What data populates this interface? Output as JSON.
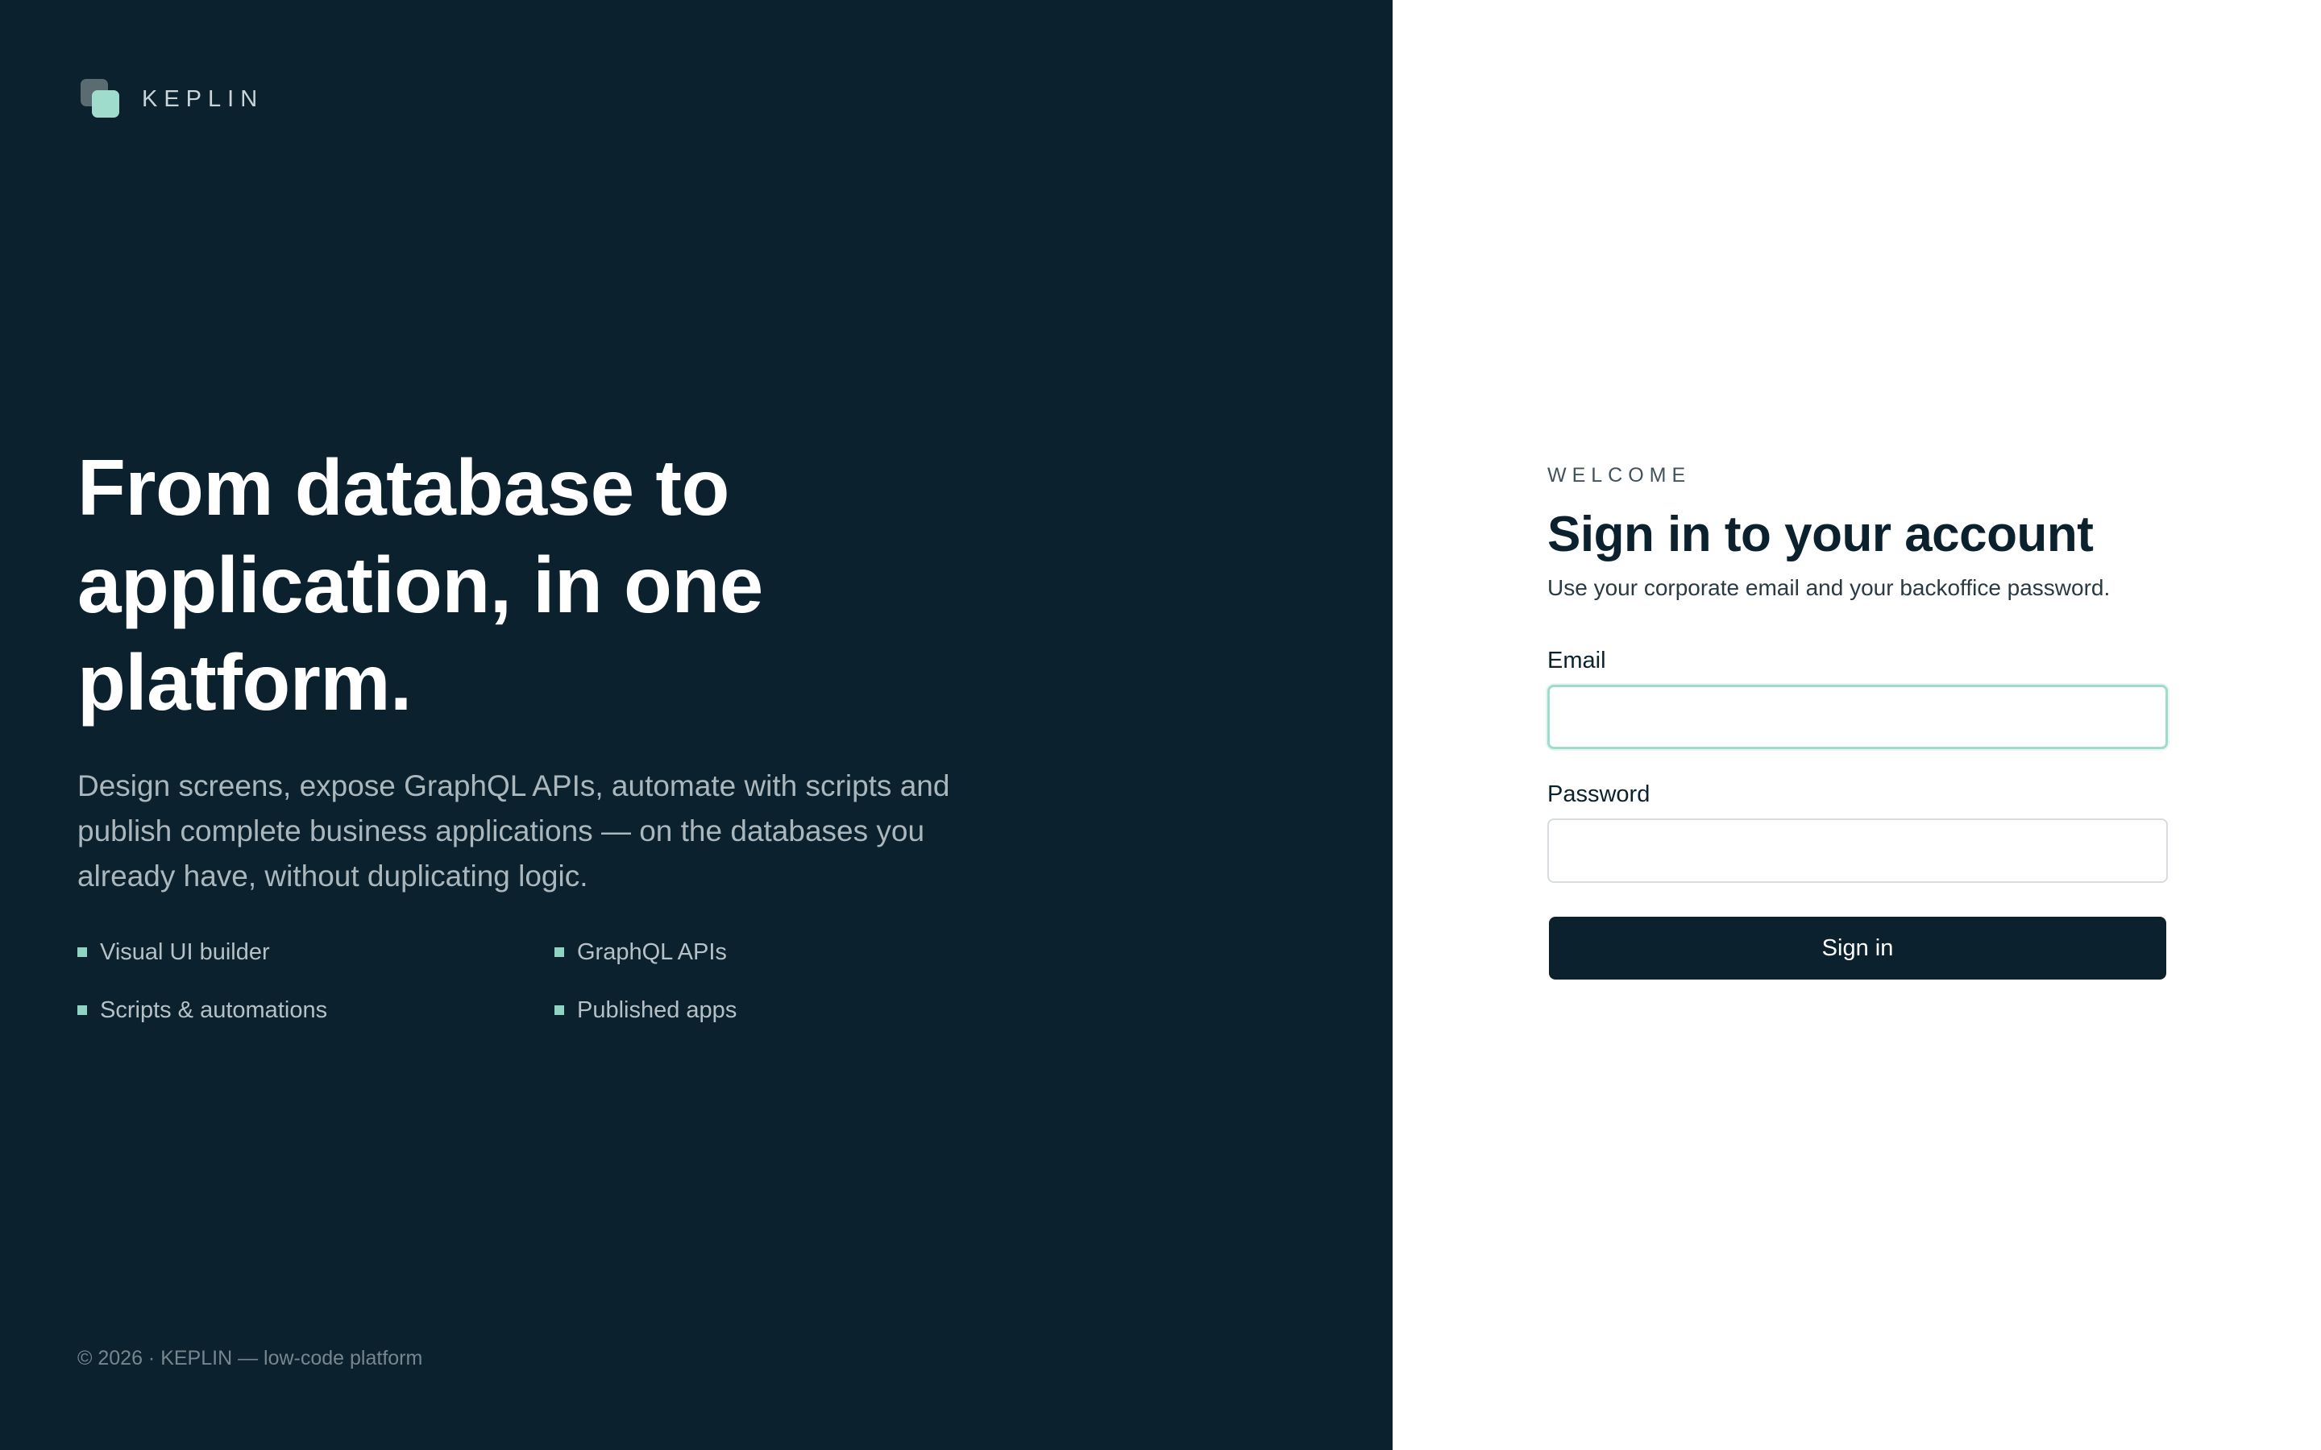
{
  "brand": {
    "name": "KEPLIN",
    "logo_icon": "stacked-squares-logo",
    "colors": {
      "panel_dark": "#0c212e",
      "accent": "#9fdccc",
      "logo_back": "#5b6b72"
    }
  },
  "hero": {
    "title": "From database to application, in one platform.",
    "subtitle": "Design screens, expose GraphQL APIs, automate with scripts and publish complete business applications — on the databases you already have, without duplicating logic.",
    "features": [
      "Visual UI builder",
      "GraphQL APIs",
      "Scripts & automations",
      "Published apps"
    ]
  },
  "footer": {
    "text": "© 2026 · KEPLIN — low-code platform"
  },
  "login": {
    "eyebrow": "WELCOME",
    "title": "Sign in to your account",
    "subtitle": "Use your corporate email and your backoffice password.",
    "email_label": "Email",
    "email_value": "",
    "email_placeholder": "",
    "password_label": "Password",
    "password_value": "",
    "password_placeholder": "",
    "submit_label": "Sign in",
    "colors": {
      "button_bg": "#0c212e",
      "focus_ring": "#9fdccc"
    }
  }
}
